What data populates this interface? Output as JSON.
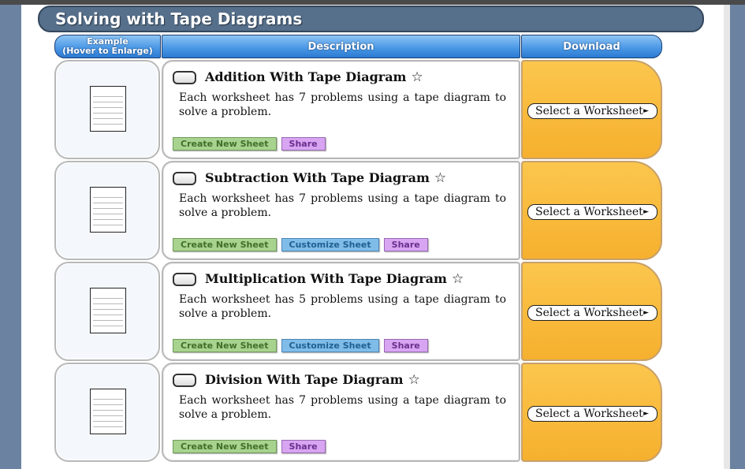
{
  "section": {
    "title": "Solving with Tape Diagrams"
  },
  "table": {
    "headers": {
      "example_line1": "Example",
      "example_line2": "(Hover to Enlarge)",
      "description": "Description",
      "download": "Download"
    },
    "rows": [
      {
        "title": "Addition With Tape Diagram",
        "star": "☆",
        "description": "Each worksheet has 7 problems using a tape diagram to solve a problem.",
        "buttons": {
          "create": "Create New Sheet",
          "customize": "",
          "share": "Share"
        },
        "select_label": "Select a Worksheet"
      },
      {
        "title": "Subtraction With Tape Diagram",
        "star": "☆",
        "description": "Each worksheet has 7 problems using a tape diagram to solve a problem.",
        "buttons": {
          "create": "Create New Sheet",
          "customize": "Customize Sheet",
          "share": "Share"
        },
        "select_label": "Select a Worksheet"
      },
      {
        "title": "Multiplication With Tape Diagram",
        "star": "☆",
        "description": "Each worksheet has 5 problems using a tape diagram to solve a problem.",
        "buttons": {
          "create": "Create New Sheet",
          "customize": "Customize Sheet",
          "share": "Share"
        },
        "select_label": "Select a Worksheet"
      },
      {
        "title": "Division With Tape Diagram",
        "star": "☆",
        "description": "Each worksheet has 7 problems using a tape diagram to solve a problem.",
        "buttons": {
          "create": "Create New Sheet",
          "customize": "",
          "share": "Share"
        },
        "select_label": "Select a Worksheet"
      }
    ]
  },
  "icons": {
    "caret": "right-triangle-icon",
    "star": "star-outline-icon",
    "toggle": "toggle-switch-icon"
  },
  "colors": {
    "background": "#6b83a1",
    "section_title": "#566f8b",
    "header_blue": "#4c99e6",
    "download_orange": "#f6b02e",
    "create_green": "#a8d38f",
    "customize_blue": "#7fbde8",
    "share_purple": "#d8a5f2"
  }
}
